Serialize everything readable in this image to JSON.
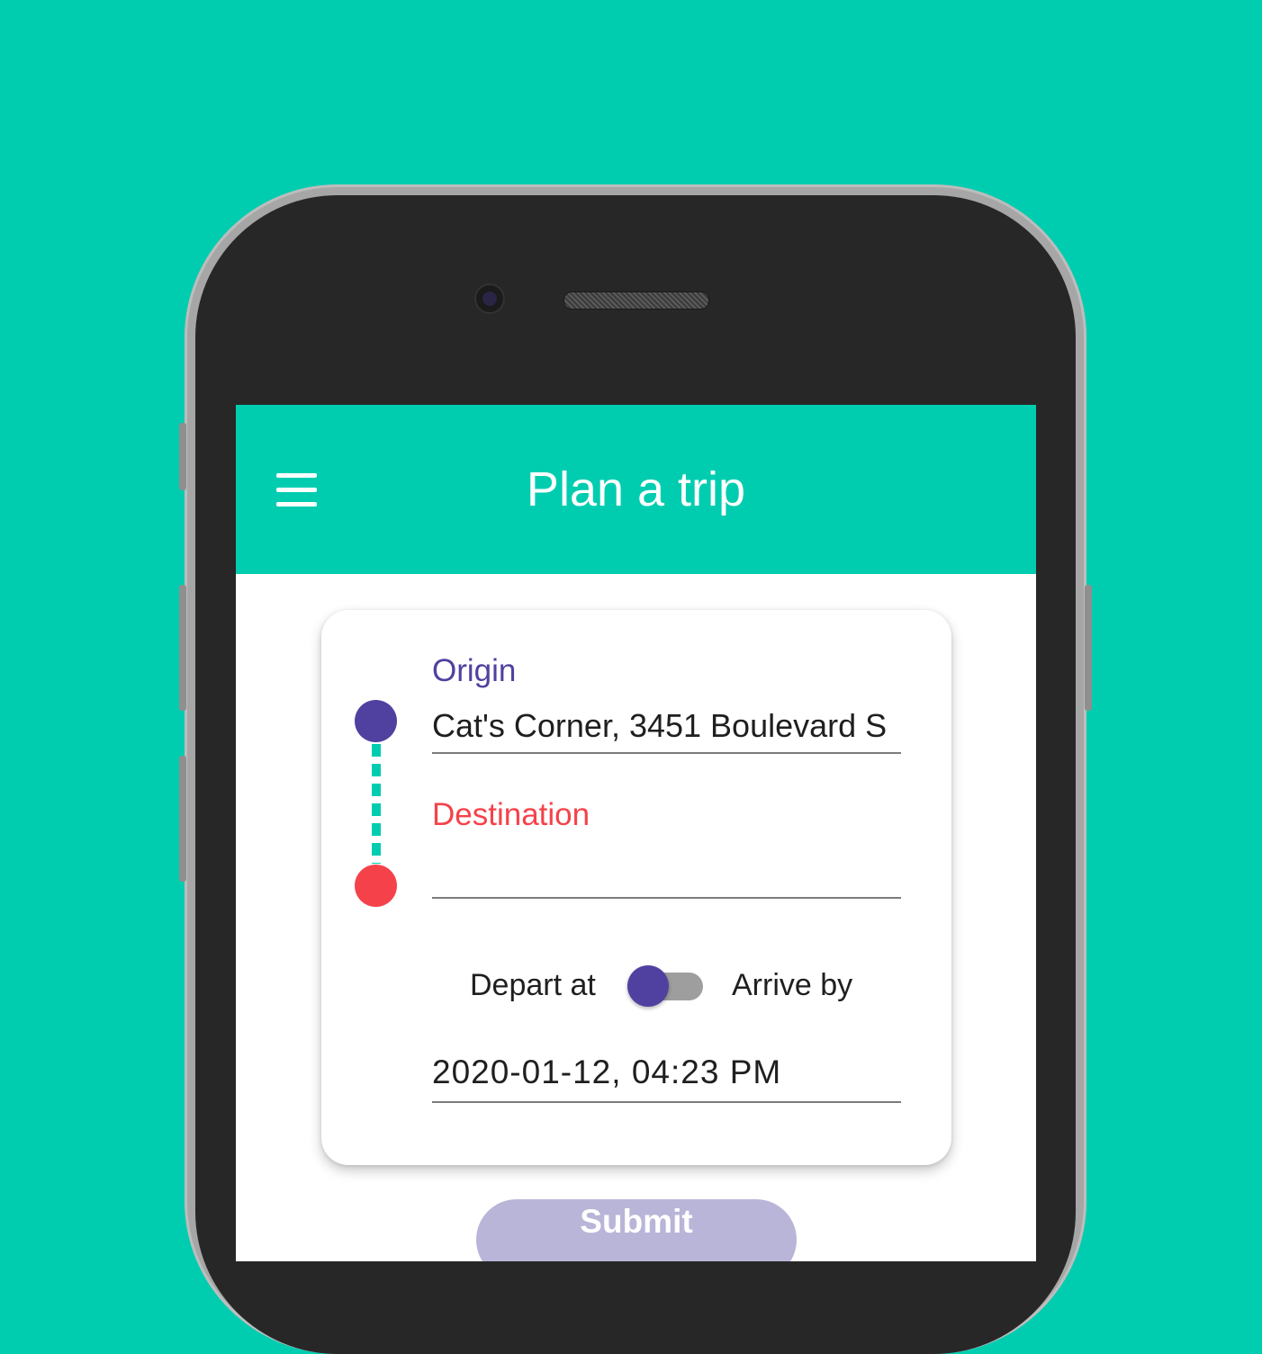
{
  "appbar": {
    "title": "Plan a trip",
    "menu_icon": "menu-icon"
  },
  "form": {
    "origin": {
      "label": "Origin",
      "value": "Cat's Corner, 3451 Boulevard S"
    },
    "destination": {
      "label": "Destination",
      "value": ""
    },
    "mode_toggle": {
      "left_label": "Depart at",
      "right_label": "Arrive by",
      "state": "Depart at"
    },
    "datetime": {
      "value": "2020-01-12, 04:23 PM"
    },
    "submit_label": "Submit"
  },
  "colors": {
    "background": "#00cdb0",
    "appbar": "#00cdb0",
    "origin_accent": "#5041a0",
    "destination_accent": "#f5424a",
    "submit_disabled": "#b9b5d8"
  }
}
